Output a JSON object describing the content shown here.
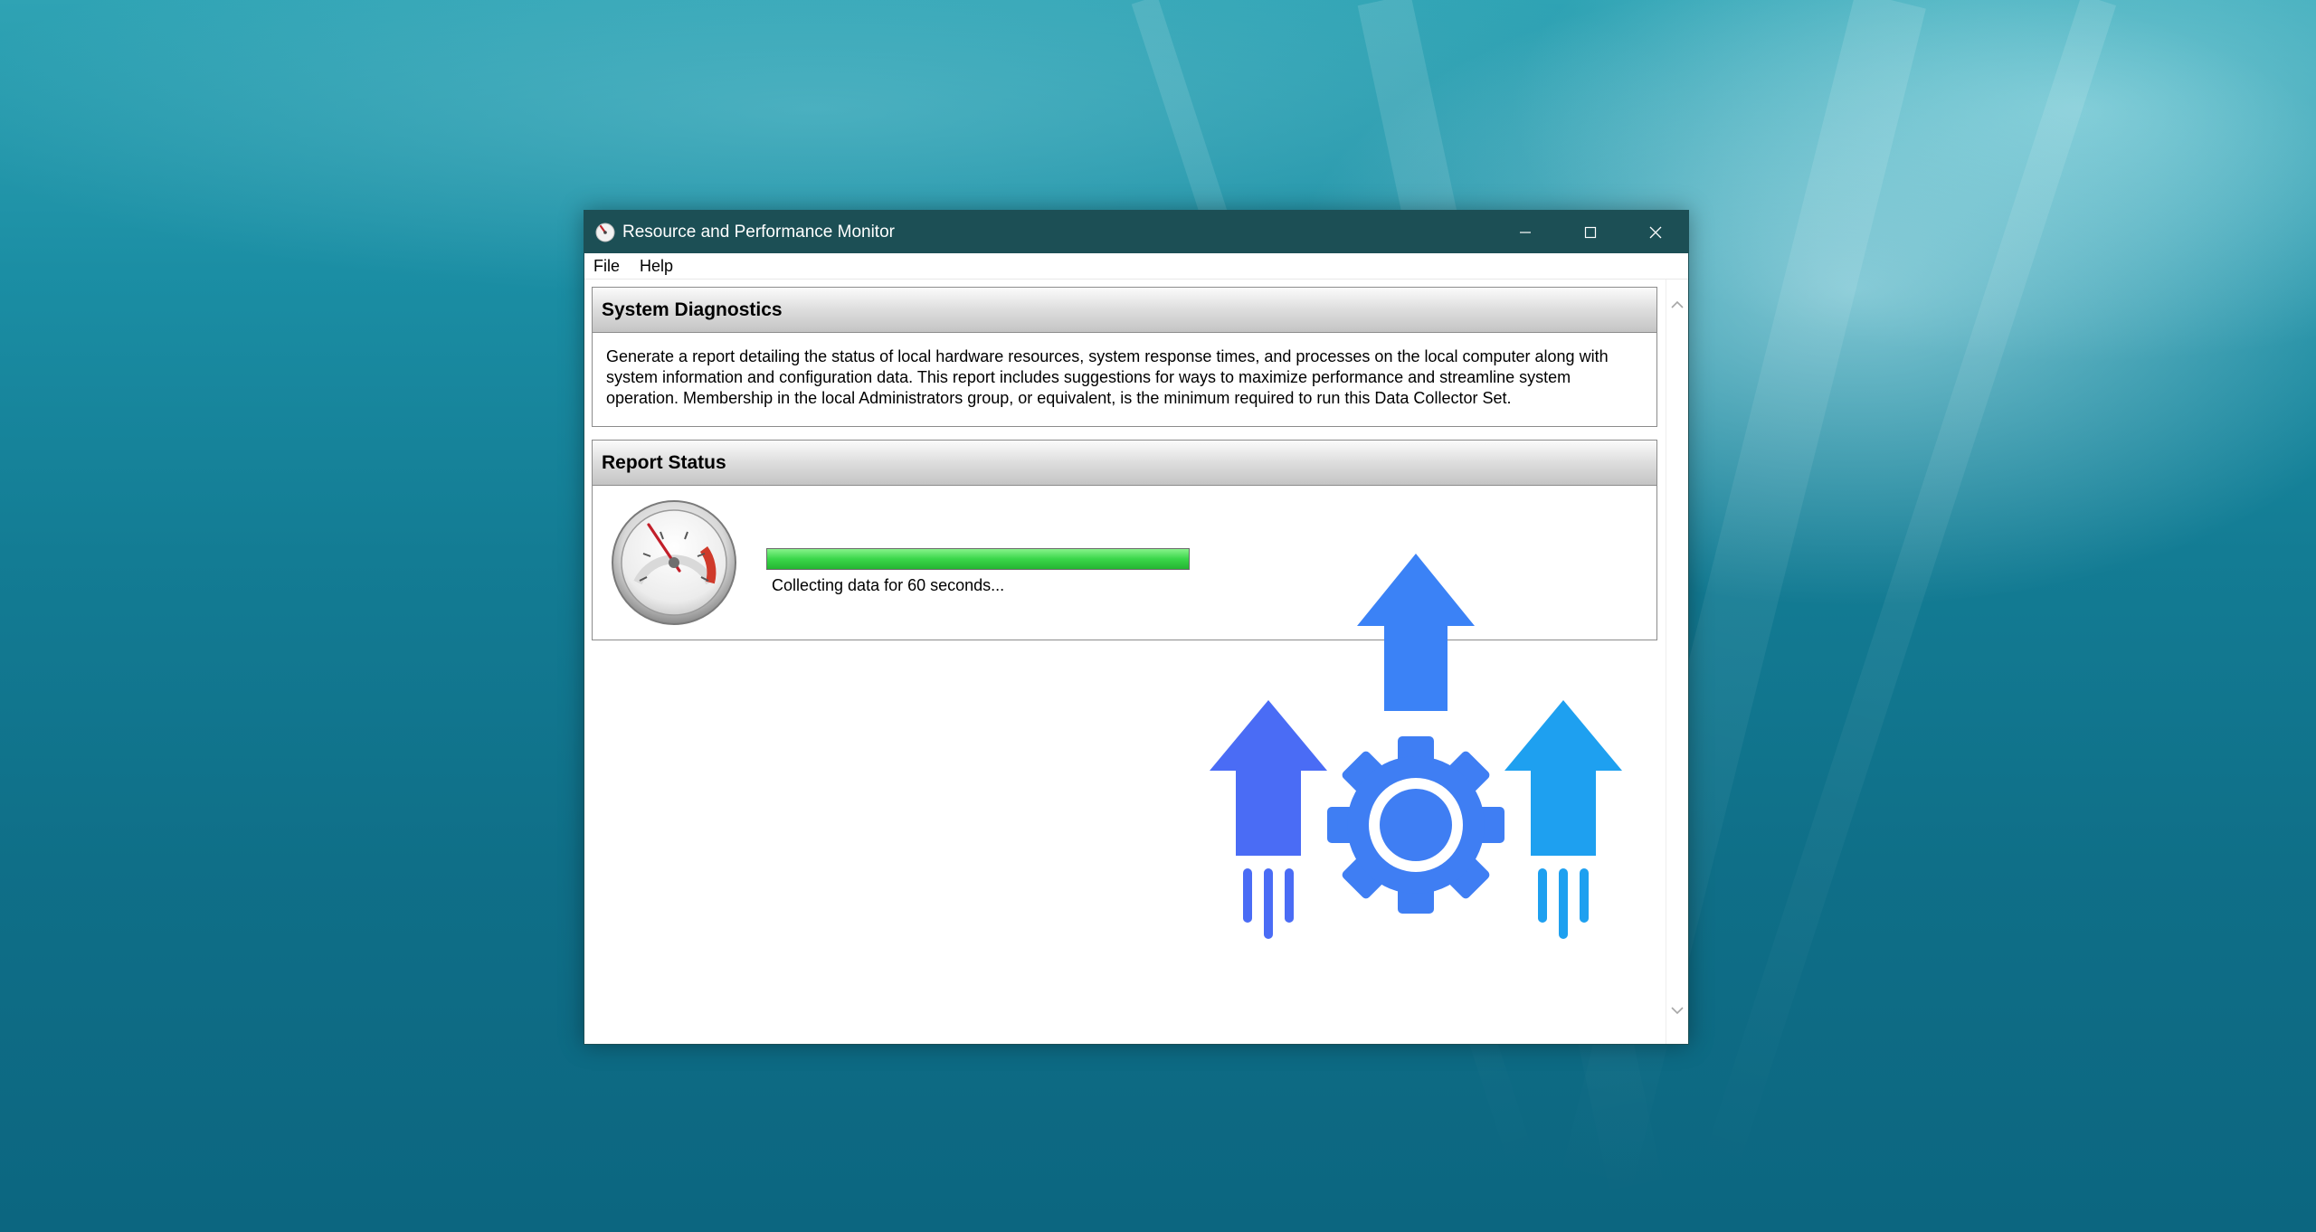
{
  "window": {
    "title": "Resource and Performance Monitor",
    "controls": {
      "minimize": "minimize-icon",
      "maximize": "maximize-icon",
      "close": "close-icon"
    }
  },
  "menu": {
    "items": [
      "File",
      "Help"
    ]
  },
  "system_diagnostics": {
    "header": "System Diagnostics",
    "description": "Generate a report detailing the status of local hardware resources, system response times, and processes on the local computer along with system information and configuration data. This report includes suggestions for ways to maximize performance and streamline system operation. Membership in the local Administrators group, or equivalent, is the minimum required to run this Data Collector Set."
  },
  "report_status": {
    "header": "Report Status",
    "progress_fraction": 1.0,
    "status_text": "Collecting data for 60 seconds..."
  },
  "colors": {
    "titlebar": "#1c4f55",
    "progress_fill": "#3ad64a",
    "overlay_arrow_left": "#4a6cf5",
    "overlay_arrow_center": "#3b82f6",
    "overlay_arrow_right": "#1ea0f0",
    "overlay_gear": "#3f7ef3"
  },
  "icons": {
    "app": "monitor-gauge-icon",
    "report": "speedometer-gauge-icon",
    "overlay": "performance-boost-gear-arrows-icon"
  }
}
